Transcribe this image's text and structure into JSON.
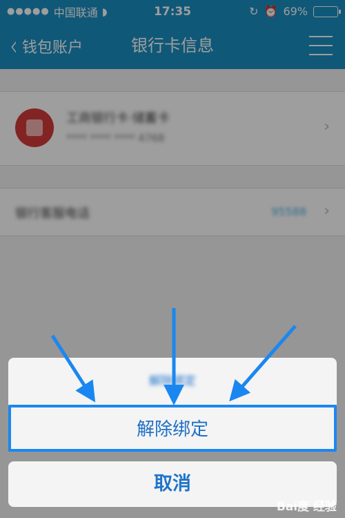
{
  "status_bar": {
    "carrier": "中国联通",
    "signal_dots": "●●●●●",
    "time": "17:35",
    "battery": "69%",
    "battery_level": 0.69
  },
  "nav": {
    "back_label": "钱包账户",
    "title": "银行卡信息"
  },
  "card": {
    "name": "工商银行卡·储蓄卡",
    "number": "**** **** **** 4768"
  },
  "service": {
    "label": "银行客服电话",
    "phone": "95588"
  },
  "action_sheet": {
    "title": "解除绑定",
    "unbind_label": "解除绑定",
    "cancel_label": "取消"
  },
  "watermark": "Bai度 经验",
  "colors": {
    "nav_bg": "#1a8ec2",
    "action_text": "#1e73c9",
    "annotation_blue": "#1a87f0"
  }
}
